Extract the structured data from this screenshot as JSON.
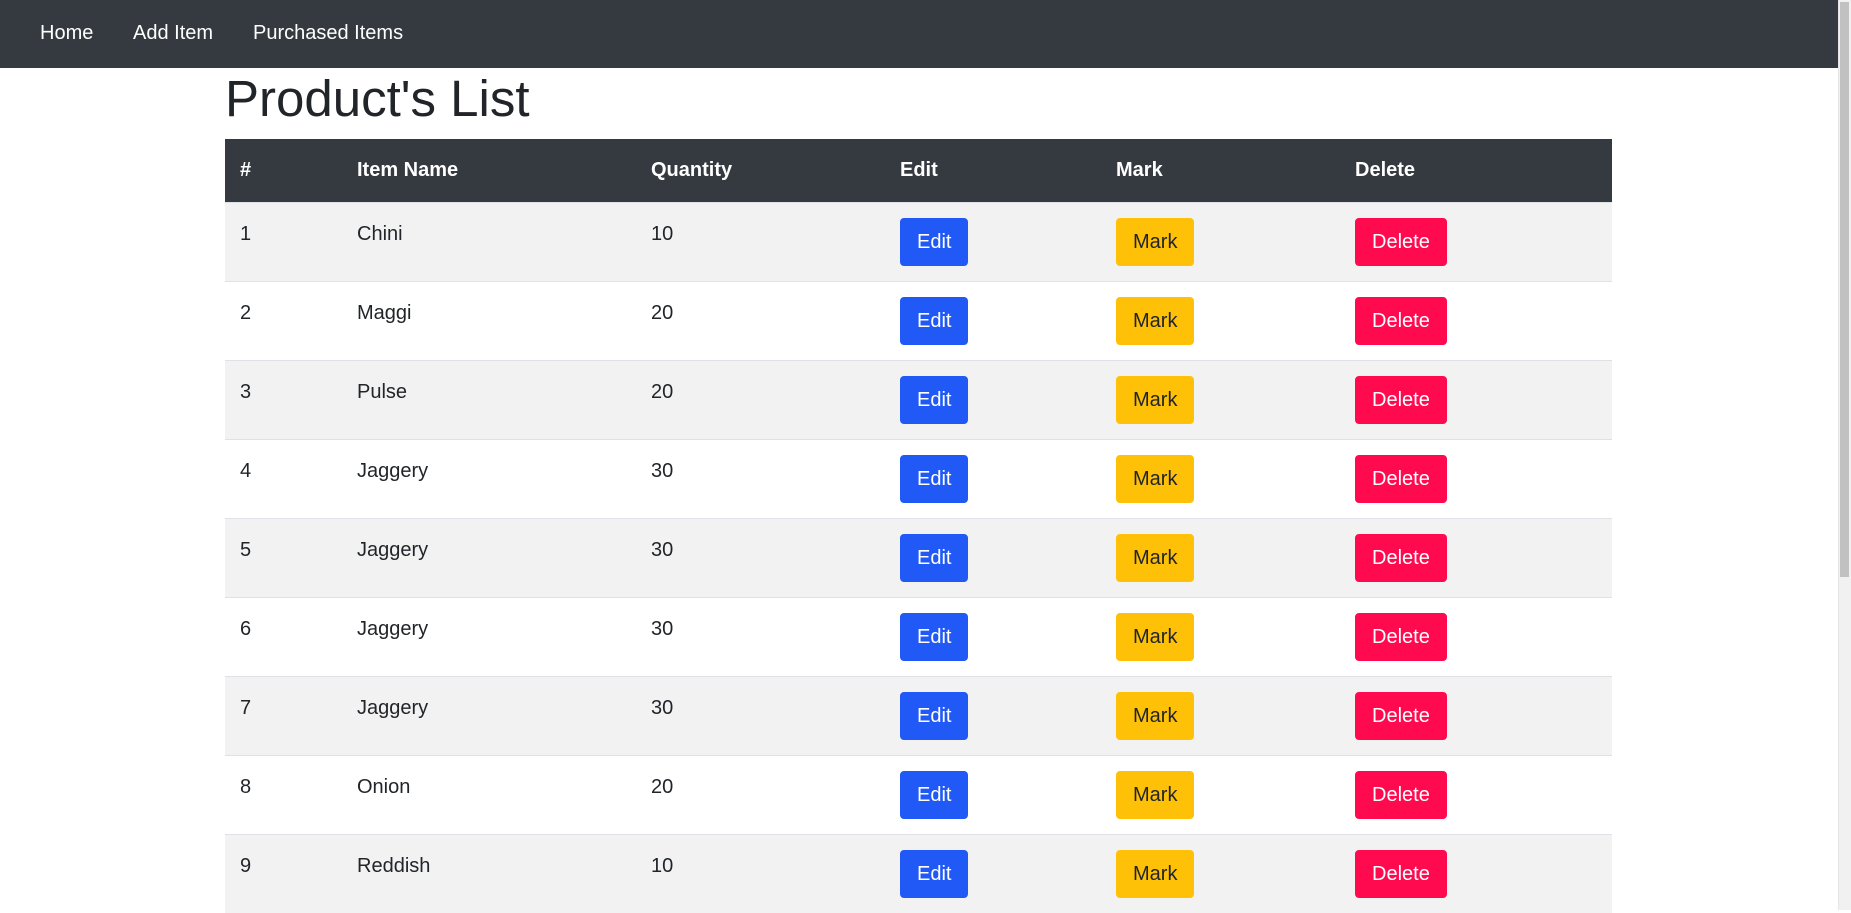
{
  "nav": {
    "home": "Home",
    "add_item": "Add Item",
    "purchased_items": "Purchased Items"
  },
  "page_title": "Product's List",
  "table": {
    "headers": [
      "#",
      "Item Name",
      "Quantity",
      "Edit",
      "Mark",
      "Delete"
    ],
    "rows": [
      {
        "num": "1",
        "name": "Chini",
        "qty": "10"
      },
      {
        "num": "2",
        "name": "Maggi",
        "qty": "20"
      },
      {
        "num": "3",
        "name": "Pulse",
        "qty": "20"
      },
      {
        "num": "4",
        "name": "Jaggery",
        "qty": "30"
      },
      {
        "num": "5",
        "name": "Jaggery",
        "qty": "30"
      },
      {
        "num": "6",
        "name": "Jaggery",
        "qty": "30"
      },
      {
        "num": "7",
        "name": "Jaggery",
        "qty": "30"
      },
      {
        "num": "8",
        "name": "Onion",
        "qty": "20"
      },
      {
        "num": "9",
        "name": "Reddish",
        "qty": "10"
      }
    ],
    "buttons": {
      "edit": "Edit",
      "mark": "Mark",
      "delete": "Delete"
    }
  },
  "colors": {
    "navbar": "#343a40",
    "edit_button": "#2059f5",
    "mark_button": "#ffc107",
    "delete_button": "#ff0a4f",
    "striped_row": "#f2f2f2"
  }
}
